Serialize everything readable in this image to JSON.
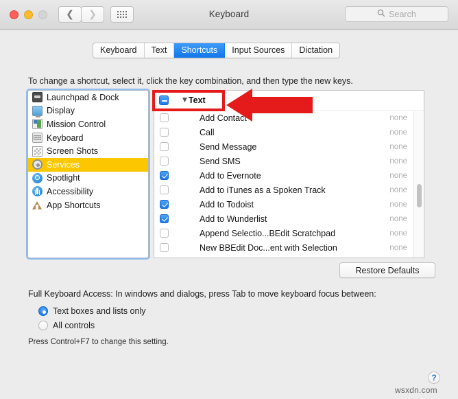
{
  "window": {
    "title": "Keyboard",
    "traffic_lights": [
      "close",
      "minimize",
      "zoom"
    ],
    "nav_back_icon": "chevron-left-icon",
    "nav_forward_icon": "chevron-right-icon",
    "grid_icon": "show-all-grid-icon",
    "search": {
      "icon": "search-icon",
      "placeholder": "Search",
      "value": ""
    }
  },
  "tabs": [
    {
      "label": "Keyboard",
      "active": false
    },
    {
      "label": "Text",
      "active": false
    },
    {
      "label": "Shortcuts",
      "active": true
    },
    {
      "label": "Input Sources",
      "active": false
    },
    {
      "label": "Dictation",
      "active": false
    }
  ],
  "hint": "To change a shortcut, select it, click the key combination, and then type the new keys.",
  "sidebar": {
    "items": [
      {
        "label": "Launchpad & Dock",
        "icon": "launchpad-dock-icon",
        "selected": false
      },
      {
        "label": "Display",
        "icon": "display-icon",
        "selected": false
      },
      {
        "label": "Mission Control",
        "icon": "mission-control-icon",
        "selected": false
      },
      {
        "label": "Keyboard",
        "icon": "keyboard-icon",
        "selected": false
      },
      {
        "label": "Screen Shots",
        "icon": "screenshot-icon",
        "selected": false
      },
      {
        "label": "Services",
        "icon": "services-gear-icon",
        "selected": true
      },
      {
        "label": "Spotlight",
        "icon": "spotlight-icon",
        "selected": false
      },
      {
        "label": "Accessibility",
        "icon": "accessibility-icon",
        "selected": false
      },
      {
        "label": "App Shortcuts",
        "icon": "app-shortcuts-icon",
        "selected": false
      }
    ]
  },
  "shortcut_list": {
    "group": {
      "label": "Text",
      "checkbox_state": "mixed",
      "disclosure": "▼",
      "disclosure_expanded": true
    },
    "rows": [
      {
        "name": "Add Contact",
        "key": "none",
        "checked": false
      },
      {
        "name": "Call",
        "key": "none",
        "checked": false
      },
      {
        "name": "Send Message",
        "key": "none",
        "checked": false
      },
      {
        "name": "Send SMS",
        "key": "none",
        "checked": false
      },
      {
        "name": "Add to Evernote",
        "key": "none",
        "checked": true
      },
      {
        "name": "Add to iTunes as a Spoken Track",
        "key": "none",
        "checked": false
      },
      {
        "name": "Add to Todoist",
        "key": "none",
        "checked": true
      },
      {
        "name": "Add to Wunderlist",
        "key": "none",
        "checked": true
      },
      {
        "name": "Append Selectio...BEdit Scratchpad",
        "key": "none",
        "checked": false
      },
      {
        "name": "New BBEdit Doc...ent with Selection",
        "key": "none",
        "checked": false
      }
    ]
  },
  "restore_button": {
    "label": "Restore Defaults"
  },
  "full_keyboard_access": {
    "label": "Full Keyboard Access: In windows and dialogs, press Tab to move keyboard focus between:",
    "options": [
      {
        "label": "Text boxes and lists only",
        "selected": true
      },
      {
        "label": "All controls",
        "selected": false
      }
    ],
    "note": "Press Control+F7 to change this setting."
  },
  "help": {
    "label": "?"
  },
  "watermark": "wsxdn.com",
  "annotations": {
    "highlight_box_color": "#e51b1b",
    "arrow_color": "#e51b1b",
    "arrow_direction": "left"
  },
  "colors": {
    "accent_blue": "#1c7ced",
    "selection_yellow": "#fdc700",
    "window_bg": "#ececec",
    "annotation_red": "#e51b1b"
  }
}
